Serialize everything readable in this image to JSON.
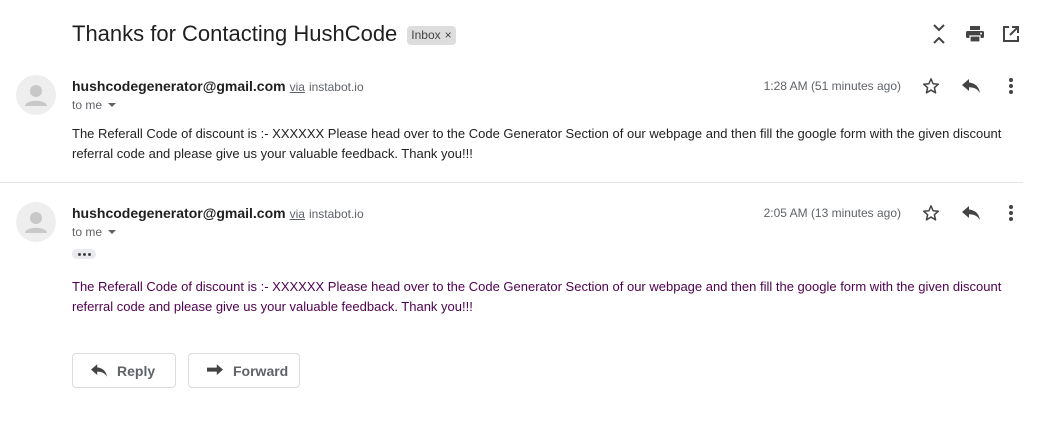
{
  "thread": {
    "subject": "Thanks for Contacting HushCode",
    "label": "Inbox",
    "label_remove": "×"
  },
  "toolbar_icons": [
    "collapse-all-icon",
    "print-icon",
    "open-in-new-window-icon"
  ],
  "messages": [
    {
      "sender": "hushcodegenerator@gmail.com",
      "via_label": "via",
      "via_domain": "instabot.io",
      "recipient": "to me",
      "time": "1:28 AM (51 minutes ago)",
      "body": "The Referall Code of discount is :- XXXXXX Please head over to the Code Generator Section of our webpage and then fill the google form with the given discount referral code and please give us your valuable feedback. Thank you!!!"
    },
    {
      "sender": "hushcodegenerator@gmail.com",
      "via_label": "via",
      "via_domain": "instabot.io",
      "recipient": "to me",
      "time": "2:05 AM (13 minutes ago)",
      "body": "The Referall Code of discount is :- XXXXXX Please head over to the Code Generator Section of our webpage and then fill the google form with the given discount referral code and please give us your valuable feedback. Thank you!!!"
    }
  ],
  "actions": {
    "reply_label": "Reply",
    "forward_label": "Forward"
  },
  "colors": {
    "quoted_text": "#500050",
    "muted": "#5f6368",
    "chip_bg": "#dddddd"
  }
}
